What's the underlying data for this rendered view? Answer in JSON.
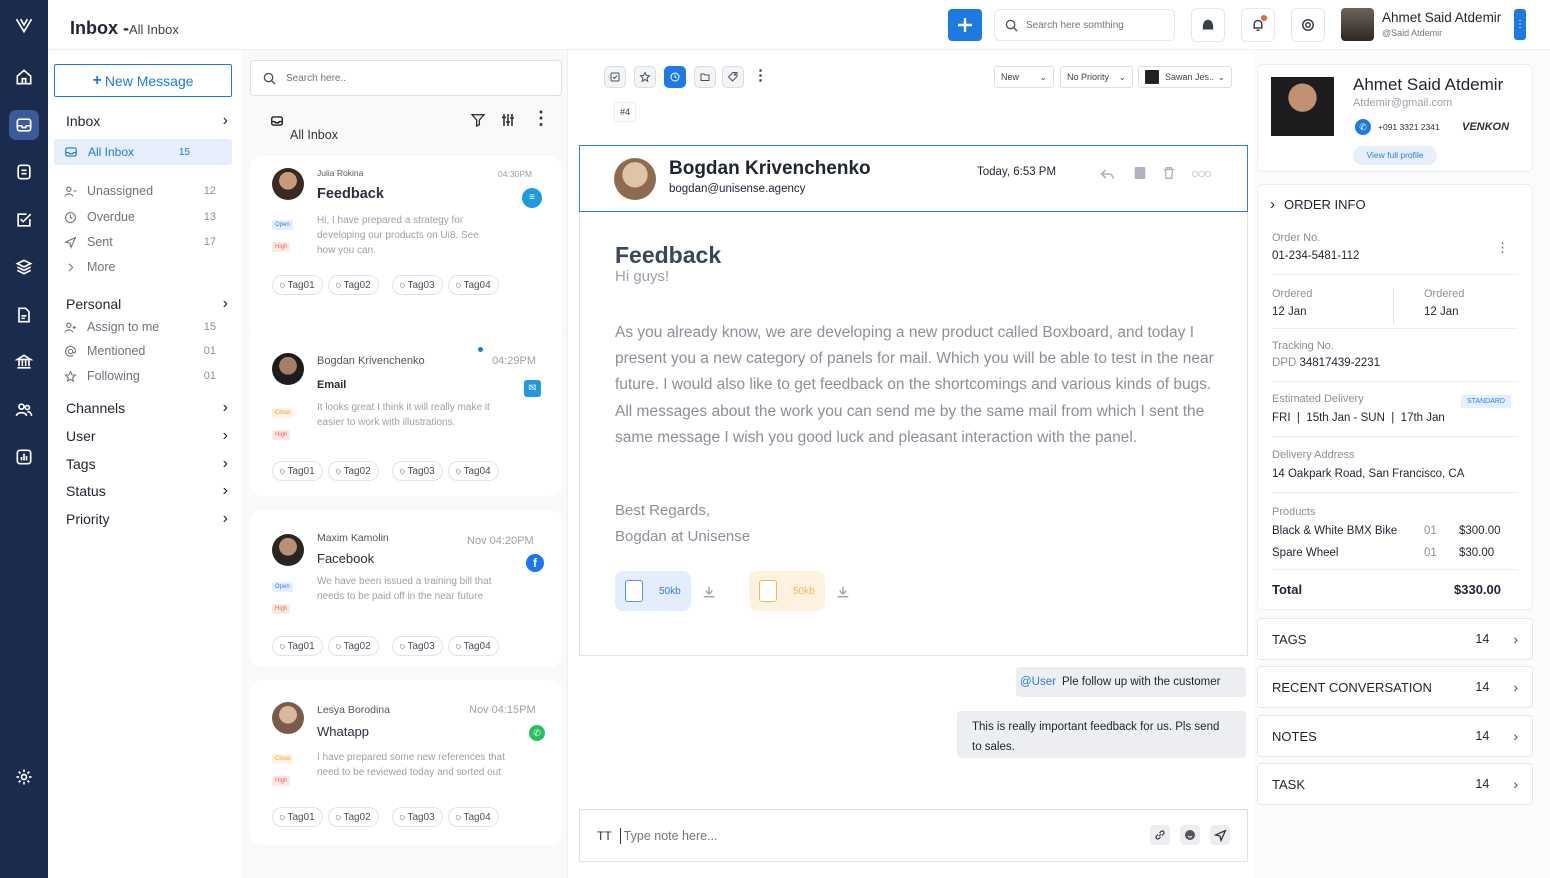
{
  "topbar": {
    "title": "Inbox -",
    "subtitle": "All Inbox",
    "search_placeholder": "Search here somthing",
    "user_name": "Ahmet Said Atdemir",
    "user_handle": "@Said Atdemir"
  },
  "sidebar": {
    "new_message": "New Message",
    "inbox": "Inbox",
    "all_inbox": "All Inbox",
    "all_inbox_count": "15",
    "inbox_items": [
      {
        "label": "Unassigned",
        "count": "12"
      },
      {
        "label": "Overdue",
        "count": "13"
      },
      {
        "label": "Sent",
        "count": "17"
      },
      {
        "label": "More",
        "count": ""
      }
    ],
    "personal": "Personal",
    "personal_items": [
      {
        "label": "Assign to me",
        "count": "15"
      },
      {
        "label": "Mentioned",
        "count": "01"
      },
      {
        "label": "Following",
        "count": "01"
      }
    ],
    "groups": [
      "Channels",
      "User",
      "Tags",
      "Status",
      "Priority"
    ]
  },
  "list": {
    "search_placeholder": "Search here..",
    "header": "All Inbox",
    "cards": [
      {
        "name": "Julia Rokina",
        "time": "04:30PM",
        "subject": "Feedback",
        "status": "Open",
        "priority": "High",
        "snippet": "Hi, I have prepared a strategy for developing our products on Ui8. See how you can.",
        "tags": [
          "Tag01",
          "Tag02",
          "Tag03",
          "Tag04"
        ]
      },
      {
        "name": "Bogdan Krivenchenko",
        "time": "04:29PM",
        "subject": "Email",
        "status": "Close",
        "priority": "High",
        "snippet": "It looks great I think it will really make it easier to work with illustrations.",
        "tags": [
          "Tag01",
          "Tag02",
          "Tag03",
          "Tag04"
        ]
      },
      {
        "name": "Maxim Kamolin",
        "time": "Nov 04:20PM",
        "subject": "Facebook",
        "status": "Open",
        "priority": "High",
        "snippet": "We have been issued a training bill that needs to be paid off in the near future",
        "tags": [
          "Tag01",
          "Tag02",
          "Tag03",
          "Tag04"
        ]
      },
      {
        "name": "Lesya Borodina",
        "time": "Nov 04:15PM",
        "subject": "Whatapp",
        "status": "Close",
        "priority": "High",
        "snippet": "I have prepared some new references that need to be reviewed today and sorted out",
        "tags": [
          "Tag01",
          "Tag02",
          "Tag03",
          "Tag04"
        ]
      }
    ]
  },
  "main": {
    "status_select": "New",
    "priority_select": "No Priority",
    "assignee_select": "Sawan Jes..",
    "ticket_no": "#4",
    "sender_name": "Bogdan Krivenchenko",
    "sender_email": "bogdan@unisense.agency",
    "sent_time": "Today, 6:53 PM",
    "subject": "Feedback",
    "greeting": "Hi guys!",
    "body": "As you already know, we are developing a new product called Boxboard, and today I present you a new category of panels for mail. Which you will be able to test in the near future. I would also like to get feedback on the shortcomings and various kinds of bugs. All messages about the work you can send me by the same mail from which I sent the same message I wish you good luck and pleasant interaction with the panel.",
    "regards_1": "Best Regards,",
    "regards_2": "Bogdan at Unisense",
    "attachments": [
      "50kb",
      "50kb"
    ],
    "note_mention": "@User",
    "note_1": "Ple follow up with the customer",
    "note_2": "This is really important feedback for us. Pls send to sales.",
    "composer_format": "TT",
    "composer_placeholder": "Type note here..."
  },
  "profile": {
    "name": "Ahmet Said Atdemir",
    "email": "Atdemir@gmail.com",
    "phone": "+091 3321 2341",
    "company": "VENKON",
    "view_profile": "View full profile"
  },
  "order": {
    "title": "ORDER INFO",
    "order_no_label": "Order No.",
    "order_no": "01-234-5481-112",
    "ordered_label_1": "Ordered",
    "ordered_1": "12 Jan",
    "ordered_label_2": "Ordered",
    "ordered_2": "12 Jan",
    "tracking_label": "Tracking No.",
    "tracking_prefix": "DPD",
    "tracking_no": "34817439-2231",
    "delivery_label": "Estimated Delivery",
    "delivery_badge": "STANDARD",
    "delivery": "FRI  |  15th Jan - SUN  |  17th Jan",
    "address_label": "Delivery Address",
    "address": "14 Oakpark Road, San Francisco, CA",
    "products_label": "Products",
    "products": [
      {
        "name": "Black & White BMX Bike",
        "qty": "01",
        "price": "$300.00"
      },
      {
        "name": "Spare Wheel",
        "qty": "01",
        "price": "$30.00"
      }
    ],
    "total_label": "Total",
    "total": "$330.00"
  },
  "sections": [
    {
      "label": "TAGS",
      "count": "14"
    },
    {
      "label": "RECENT CONVERSATION",
      "count": "14"
    },
    {
      "label": "NOTES",
      "count": "14"
    },
    {
      "label": "TASK",
      "count": "14"
    }
  ],
  "colors": {
    "rail": "#1b2b4d",
    "accent": "#1f7ae0",
    "highlight": "#e6effb"
  }
}
